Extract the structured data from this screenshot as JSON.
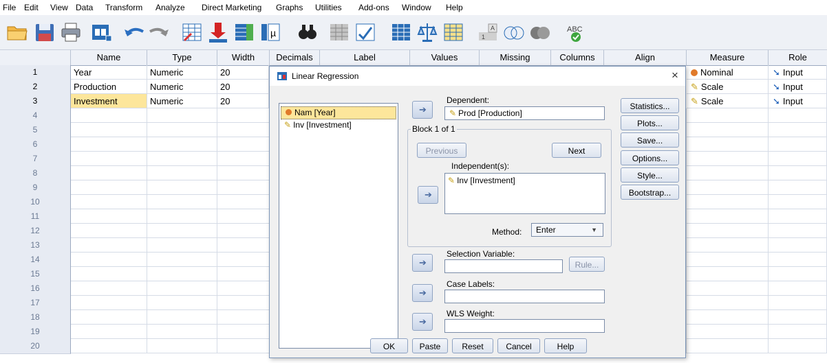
{
  "menu": [
    "File",
    "Edit",
    "View",
    "Data",
    "Transform",
    "Analyze",
    "Direct Marketing",
    "Graphs",
    "Utilities",
    "Add-ons",
    "Window",
    "Help"
  ],
  "toolbar_icons": [
    "open-folder-icon",
    "save-icon",
    "print-icon",
    "dialog-recall-icon",
    "undo-icon",
    "redo-icon",
    "goto-case-icon",
    "goto-variable-icon",
    "variables-icon",
    "run-descriptives-icon",
    "find-icon",
    "insert-cases-icon",
    "insert-variable-icon",
    "split-file-icon",
    "weight-cases-icon",
    "select-cases-icon",
    "value-labels-icon",
    "use-sets-icon",
    "show-all-icon",
    "spell-check-icon"
  ],
  "columns": [
    "Name",
    "Type",
    "Width",
    "Decimals",
    "Label",
    "Values",
    "Missing",
    "Columns",
    "Align",
    "Measure",
    "Role"
  ],
  "rows": [
    {
      "num": "1",
      "name": "Year",
      "type": "Numeric",
      "width": "20",
      "measure": "Nominal",
      "role": "Input"
    },
    {
      "num": "2",
      "name": "Production",
      "type": "Numeric",
      "width": "20",
      "measure": "Scale",
      "role": "Input"
    },
    {
      "num": "3",
      "name": "Investment",
      "type": "Numeric",
      "width": "20",
      "measure": "Scale",
      "role": "Input"
    }
  ],
  "empty_rows": [
    "4",
    "5",
    "6",
    "7",
    "8",
    "9",
    "10",
    "11",
    "12",
    "13",
    "14",
    "15",
    "16",
    "17",
    "18",
    "19",
    "20"
  ],
  "dialog": {
    "title": "Linear Regression",
    "close": "×",
    "source_list": [
      "Nam [Year]",
      "Inv [Investment]"
    ],
    "dependent_label": "Dependent:",
    "dependent_value": "Prod [Production]",
    "block_label": "Block 1 of 1",
    "previous": "Previous",
    "next": "Next",
    "independents_label": "Independent(s):",
    "independents_value": "Inv [Investment]",
    "method_label": "Method:",
    "method_value": "Enter",
    "selection_label": "Selection Variable:",
    "rule": "Rule...",
    "case_labels_label": "Case Labels:",
    "wls_label": "WLS Weight:",
    "side_buttons": [
      "Statistics...",
      "Plots...",
      "Save...",
      "Options...",
      "Style...",
      "Bootstrap..."
    ],
    "bottom_buttons": [
      "OK",
      "Paste",
      "Reset",
      "Cancel",
      "Help"
    ]
  }
}
